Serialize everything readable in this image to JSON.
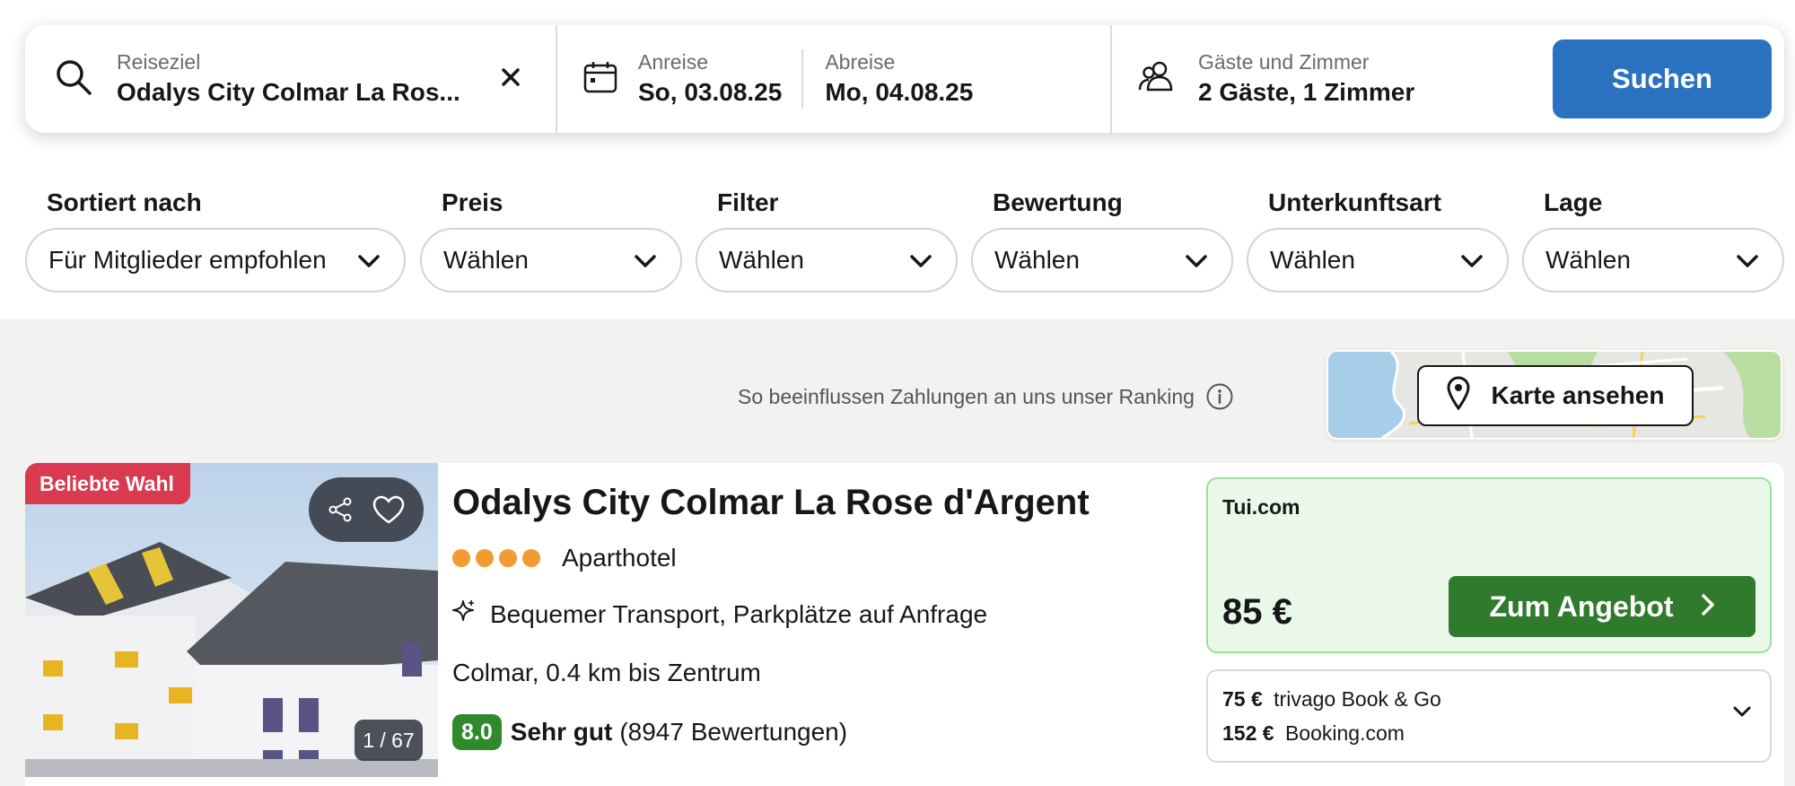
{
  "search": {
    "destination_label": "Reiseziel",
    "destination_value": "Odalys City Colmar La Ros...",
    "checkin_label": "Anreise",
    "checkin_value": "So, 03.08.25",
    "checkout_label": "Abreise",
    "checkout_value": "Mo, 04.08.25",
    "guests_label": "Gäste und Zimmer",
    "guests_value": "2 Gäste, 1 Zimmer",
    "search_button": "Suchen",
    "icons": [
      "search-icon",
      "close-icon",
      "calendar-icon",
      "guests-icon"
    ],
    "accent_color": "#2a72bf"
  },
  "filters": [
    {
      "label": "Sortiert nach",
      "value": "Für Mitglieder empfohlen"
    },
    {
      "label": "Preis",
      "value": "Wählen"
    },
    {
      "label": "Filter",
      "value": "Wählen"
    },
    {
      "label": "Bewertung",
      "value": "Wählen"
    },
    {
      "label": "Unterkunftsart",
      "value": "Wählen"
    },
    {
      "label": "Lage",
      "value": "Wählen"
    }
  ],
  "ranking_note": "So beeinflussen Zahlungen an uns unser Ranking",
  "map": {
    "button_label": "Karte ansehen",
    "icon": "map-pin-icon"
  },
  "hotel": {
    "badge": "Beliebte Wahl",
    "image_counter": "1 / 67",
    "name": "Odalys City Colmar La Rose d'Argent",
    "stars": 4,
    "type": "Aparthotel",
    "amenities": "Bequemer Transport, Parkplätze auf Anfrage",
    "location": "Colmar, 0.4 km bis Zentrum",
    "rating_score": "8.0",
    "rating_label": "Sehr gut",
    "rating_count": "(8947 Bewertungen)",
    "deal": {
      "provider": "Tui.com",
      "price": "85 €",
      "button": "Zum Angebot",
      "color": "#2f7a2c"
    },
    "other_deals": [
      {
        "price": "75 €",
        "provider": "trivago Book & Go"
      },
      {
        "price": "152 €",
        "provider": "Booking.com"
      }
    ]
  }
}
